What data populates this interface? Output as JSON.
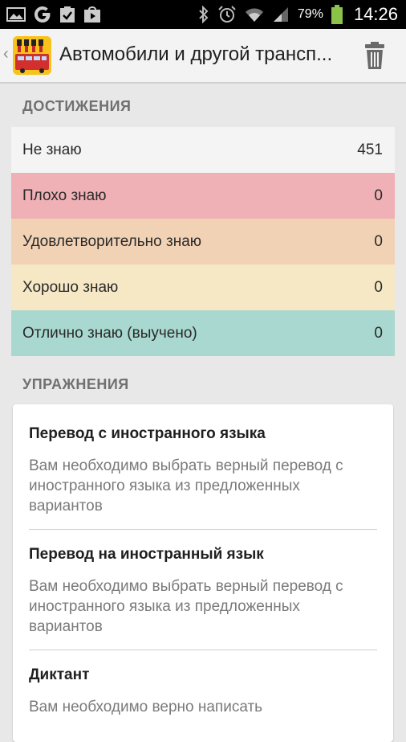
{
  "status_bar": {
    "battery_percent": "79%",
    "time": "14:26"
  },
  "action_bar": {
    "title": "Автомобили и другой трансп..."
  },
  "achievements": {
    "header": "ДОСТИЖЕНИЯ",
    "rows": [
      {
        "label": "Не знаю",
        "count": "451",
        "color": "#f4f4f4"
      },
      {
        "label": "Плохо знаю",
        "count": "0",
        "color": "#efb0b6"
      },
      {
        "label": "Удовлетворительно знаю",
        "count": "0",
        "color": "#f2d2b5"
      },
      {
        "label": "Хорошо знаю",
        "count": "0",
        "color": "#f6e8c5"
      },
      {
        "label": "Отлично знаю (выучено)",
        "count": "0",
        "color": "#a8d8cf"
      }
    ]
  },
  "exercises": {
    "header": "УПРАЖНЕНИЯ",
    "items": [
      {
        "title": "Перевод с иностранного языка",
        "desc": "Вам необходимо выбрать верный перевод с иностранного языка из предложенных вариантов"
      },
      {
        "title": "Перевод на иностранный язык",
        "desc": "Вам необходимо выбрать верный перевод с иностранного языка из предложенных вариантов"
      },
      {
        "title": "Диктант",
        "desc": "Вам необходимо верно написать"
      }
    ]
  }
}
